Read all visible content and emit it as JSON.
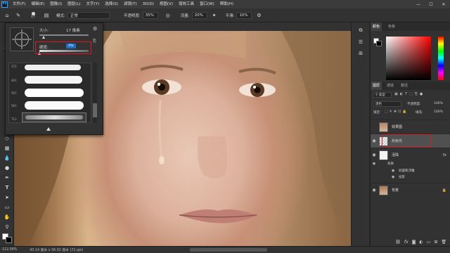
{
  "app": {
    "logo": "Ps"
  },
  "menu": [
    "文件(F)",
    "编辑(E)",
    "图像(I)",
    "图层(L)",
    "文字(Y)",
    "选择(S)",
    "滤镜(T)",
    "3D(D)",
    "视图(V)",
    "增效工具",
    "窗口(W)",
    "帮助(H)"
  ],
  "window_controls": [
    "—",
    "☐",
    "✕"
  ],
  "options": {
    "brush_size": "17",
    "mode_label": "模式:",
    "mode_value": "正常",
    "opacity_label": "不透明度:",
    "opacity_value": "35%",
    "flow_label": "流量:",
    "flow_value": "20%",
    "smooth_label": "平滑:",
    "smooth_value": "10%"
  },
  "brush_panel": {
    "size_label": "大小:",
    "size_value": "17 像素",
    "hardness_label": "硬度:",
    "hardness_value": "0%",
    "brush_numbers": [
      "372",
      "401",
      "567",
      "561",
      "712"
    ]
  },
  "status": {
    "zoom": "122.08%",
    "doc_info": "43.14 厘米 x 56.02 厘米 (72 ppi)"
  },
  "panels": {
    "top_tabs": [
      "颜色",
      "色板"
    ],
    "layer_tabs": [
      "图层",
      "通道",
      "路径"
    ],
    "filter_kind": "类型",
    "blend_mode": "透色",
    "opacity_label": "不透明度:",
    "opacity_value": "100%",
    "lock_label": "锁定:",
    "fill_label": "填充:",
    "fill_value": "100%",
    "layers": [
      {
        "name": "效果图",
        "visible": false
      },
      {
        "name": "反射光",
        "visible": true
      },
      {
        "name": "泪珠",
        "visible": true,
        "fx": "fx"
      },
      {
        "name": "效果",
        "visible": true,
        "sub": true
      },
      {
        "name": "斜面和浮雕",
        "visible": true,
        "sub": true
      },
      {
        "name": "投影",
        "visible": true,
        "sub": true
      },
      {
        "name": "背景",
        "visible": true,
        "locked": true
      }
    ],
    "footer_icons": [
      "link-icon",
      "fx-icon",
      "mask-icon",
      "adjustment-icon",
      "group-icon",
      "new-layer-icon",
      "trash-icon"
    ]
  },
  "colors": {
    "accent": "#31a8ff",
    "highlight": "#d8192a",
    "selected_layer": "#505050"
  }
}
